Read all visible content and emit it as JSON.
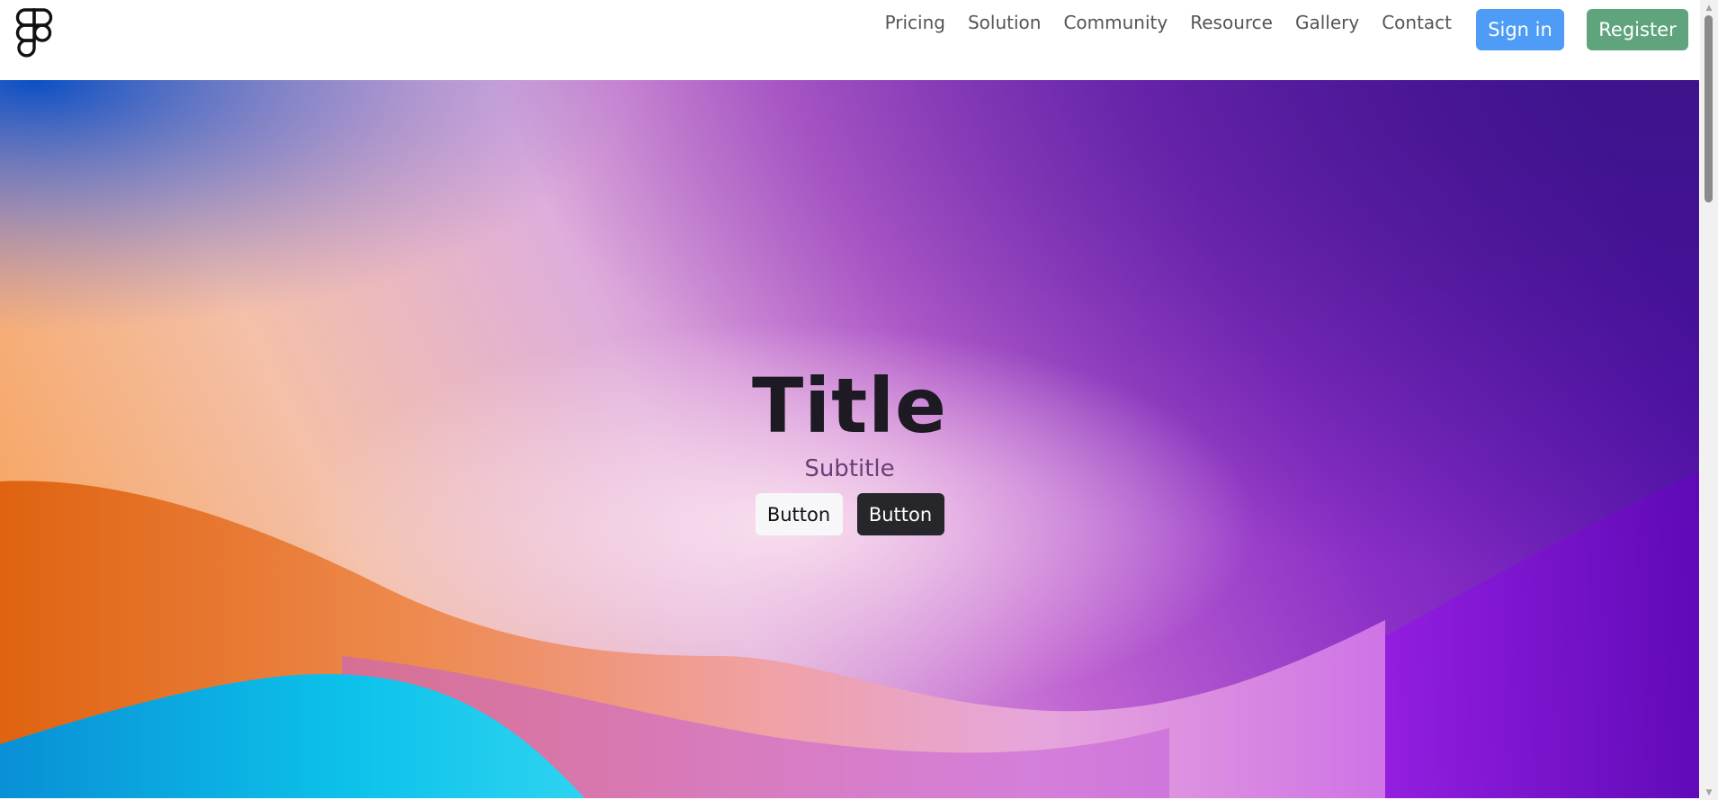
{
  "header": {
    "logo_icon": "figma-logo-icon",
    "nav": [
      {
        "label": "Pricing"
      },
      {
        "label": "Solution"
      },
      {
        "label": "Community"
      },
      {
        "label": "Resource"
      },
      {
        "label": "Gallery"
      },
      {
        "label": "Contact"
      }
    ],
    "signin_label": "Sign in",
    "register_label": "Register",
    "colors": {
      "signin": "#4e9cf5",
      "register": "#5fa47c"
    }
  },
  "hero": {
    "title": "Title",
    "subtitle": "Subtitle",
    "button_primary_label": "Button",
    "button_secondary_label": "Button",
    "colors": {
      "gradient_left": "#f6a869",
      "gradient_center": "#e6b6e0",
      "gradient_right": "#5a0fb4",
      "wave_orange": "#e66a12",
      "wave_cyan": "#0fc0e8"
    }
  },
  "scrollbar": {
    "up_icon": "chevron-up-icon",
    "down_icon": "chevron-down-icon"
  }
}
